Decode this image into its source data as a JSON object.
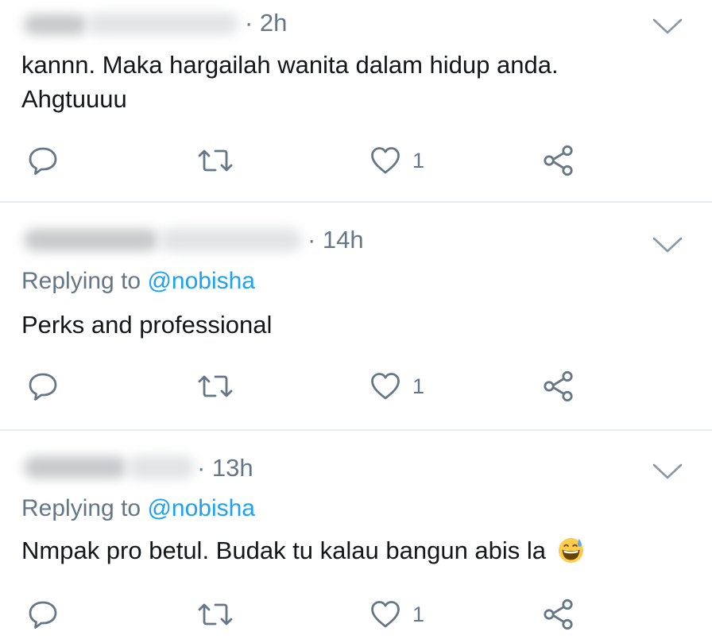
{
  "tweets": [
    {
      "time": "· 2h",
      "replying_label": "",
      "replying_handle": "",
      "lines": [
        "kannn. Maka hargailah wanita dalam hidup anda.",
        "Ahgtuuuu"
      ],
      "like_count": "1"
    },
    {
      "time": "· 14h",
      "replying_label": "Replying to",
      "replying_handle": "@nobisha",
      "lines": [
        "Perks and professional"
      ],
      "like_count": "1"
    },
    {
      "time": "· 13h",
      "replying_label": "Replying to",
      "replying_handle": "@nobisha",
      "lines": [
        "Nmpak pro betul. Budak tu kalau bangun abis la"
      ],
      "emoji": "grinning-face-with-sweat-emoji",
      "like_count": "1"
    }
  ],
  "icons": {
    "reply": "reply-icon",
    "retweet": "retweet-icon",
    "like": "heart-icon",
    "share": "share-icon",
    "menu": "chevron-down-icon"
  },
  "colors": {
    "text": "#14171a",
    "secondary": "#657786",
    "link": "#1da1f2",
    "divider": "#e6ecf0"
  }
}
